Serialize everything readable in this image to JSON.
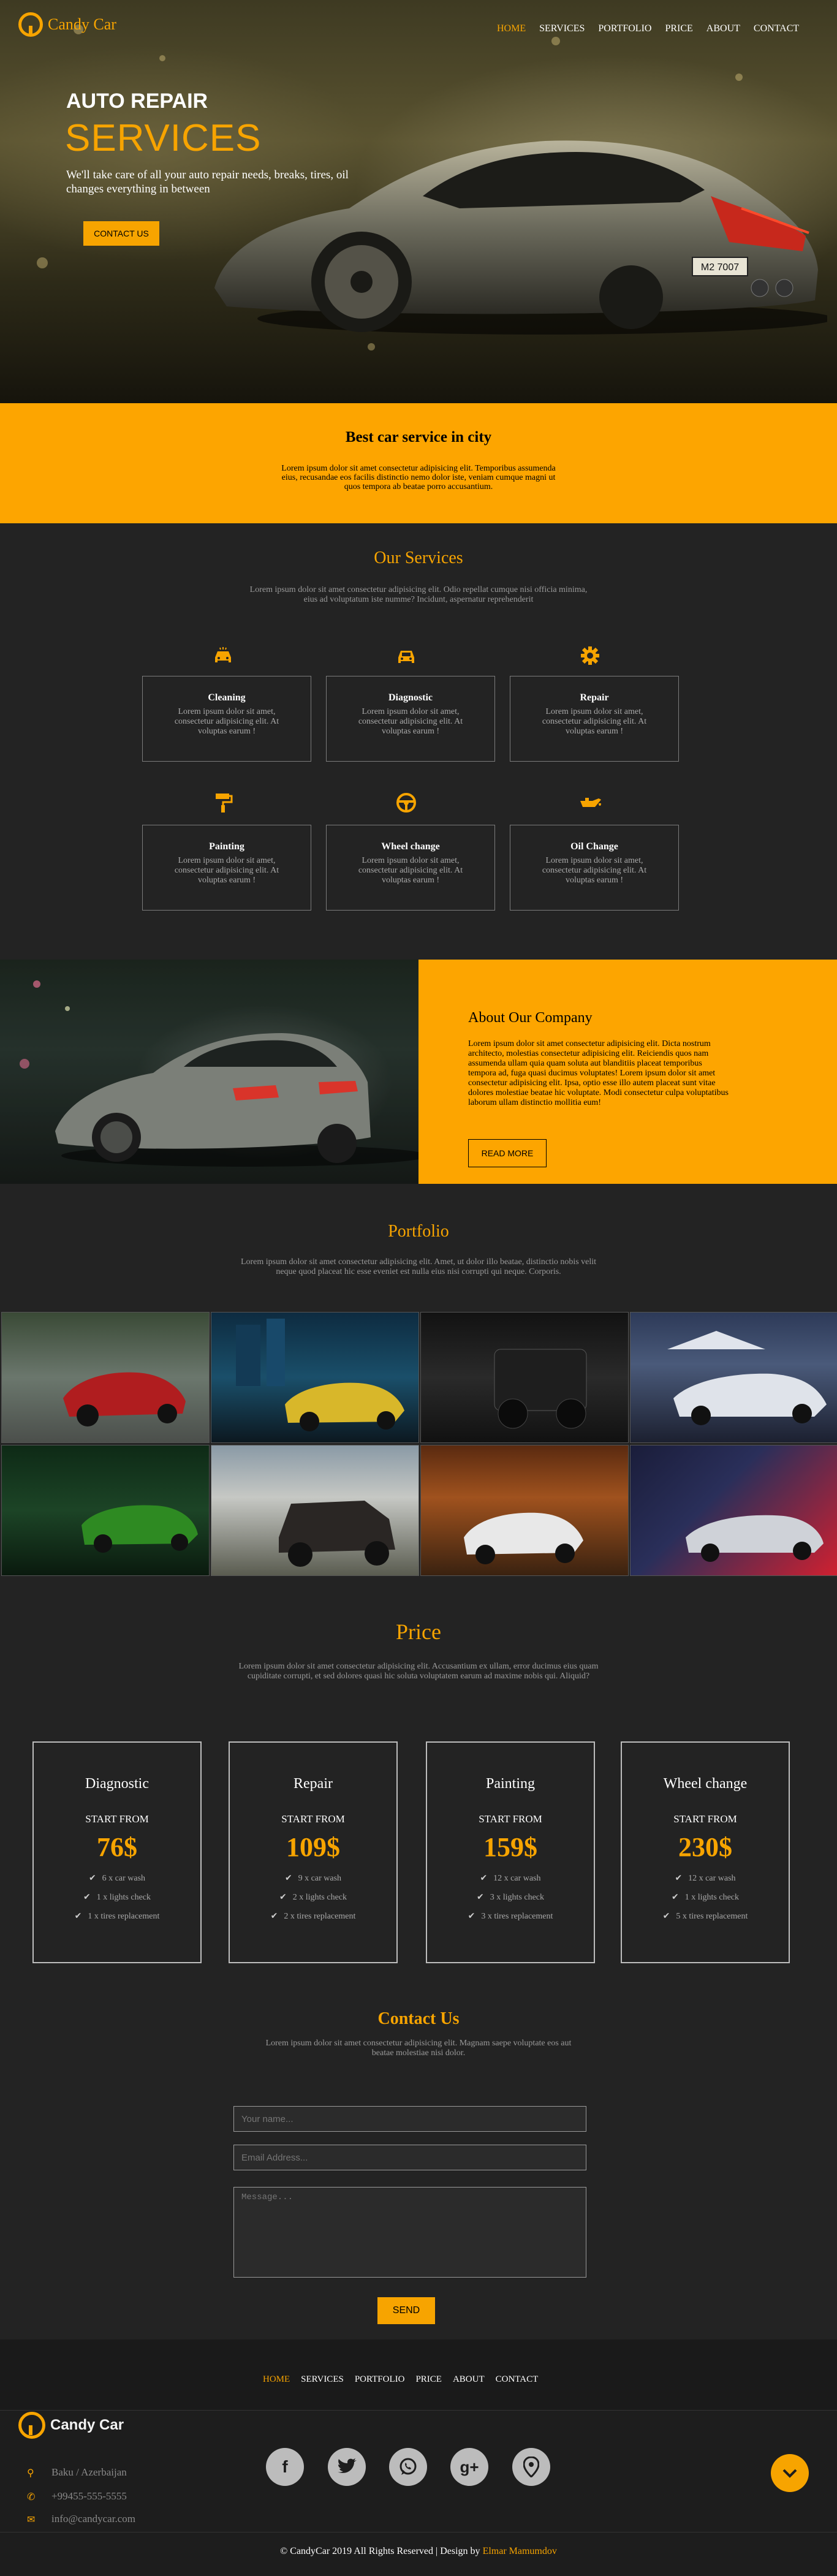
{
  "brand": {
    "name": "Candy Car",
    "name_part1": "Candy",
    "name_part2": "Car"
  },
  "nav": {
    "items": [
      "HOME",
      "SERVICES",
      "PORTFOLIO",
      "PRICE",
      "ABOUT",
      "CONTACT"
    ],
    "active": "HOME"
  },
  "hero": {
    "line1": "AUTO REPAIR",
    "line2": "SERVICES",
    "desc": "We'll take care of all your auto repair needs, breaks, tires, oil changes everything in between",
    "button": "CONTACT US",
    "plate": "M2 7007"
  },
  "best": {
    "title": "Best car service in city",
    "text": "Lorem ipsum dolor sit amet consectetur adipisicing elit. Temporibus assumenda eius, recusandae eos facilis distinctio nemo dolor iste, veniam cumque magni ut quos tempora ab beatae porro accusantium."
  },
  "services": {
    "title": "Our Services",
    "subtitle": "Lorem ipsum dolor sit amet consectetur adipisicing elit. Odio repellat cumque nisi officia minima, eius ad voluptatum iste numme? Incidunt, aspernatur reprehenderit",
    "items": [
      {
        "name": "Cleaning",
        "icon": "cleaning-car-icon",
        "desc": "Lorem ipsum dolor sit amet, consectetur adipisicing elit. At voluptas earum !"
      },
      {
        "name": "Diagnostic",
        "icon": "diagnostic-car-icon",
        "desc": "Lorem ipsum dolor sit amet, consectetur adipisicing elit. At voluptas earum !"
      },
      {
        "name": "Repair",
        "icon": "gear-icon",
        "desc": "Lorem ipsum dolor sit amet, consectetur adipisicing elit. At voluptas earum !"
      },
      {
        "name": "Painting",
        "icon": "paint-roller-icon",
        "desc": "Lorem ipsum dolor sit amet, consectetur adipisicing elit. At voluptas earum !"
      },
      {
        "name": "Wheel change",
        "icon": "steering-wheel-icon",
        "desc": "Lorem ipsum dolor sit amet, consectetur adipisicing elit. At voluptas earum !"
      },
      {
        "name": "Oil Change",
        "icon": "oil-can-icon",
        "desc": "Lorem ipsum dolor sit amet, consectetur adipisicing elit. At voluptas earum !"
      }
    ]
  },
  "about": {
    "title": "About Our Company",
    "text": "Lorem ipsum dolor sit amet consectetur adipisicing elit. Dicta nostrum architecto, molestias consectetur adipisicing elit. Reiciendis quos nam assumenda ullam quia quam soluta aut blanditiis placeat temporibus tempora ad, fuga quasi ducimus voluptates! Lorem ipsum dolor sit amet consectetur adipisicing elit. Ipsa, optio esse illo autem placeat sunt vitae dolores molestiae beatae hic voluptate. Modi consectetur culpa voluptatibus laborum ullam distinctio mollitia eum!",
    "button": "READ MORE"
  },
  "portfolio": {
    "title": "Portfolio",
    "subtitle": "Lorem ipsum dolor sit amet consectetur adipisicing elit. Amet, ut dolor illo beatae, distinctio nobis velit neque quod placeat hic esse eveniet est nulla eius nisi corrupti qui neque. Corporis."
  },
  "price": {
    "title": "Price",
    "subtitle": "Lorem ipsum dolor sit amet consectetur adipisicing elit. Accusantium ex ullam, error ducimus eius quam cupiditate corrupti, et sed dolores quasi hic soluta voluptatem earum ad maxime nobis qui. Aliquid?",
    "start_label": "START FROM",
    "plans": [
      {
        "name": "Diagnostic",
        "price": "76$",
        "features": [
          "6 x car wash",
          "1 x lights check",
          "1 x tires replacement"
        ]
      },
      {
        "name": "Repair",
        "price": "109$",
        "features": [
          "9 x car wash",
          "2 x lights check",
          "2 x tires replacement"
        ]
      },
      {
        "name": "Painting",
        "price": "159$",
        "features": [
          "12 x car wash",
          "3 x lights check",
          "3 x tires replacement"
        ]
      },
      {
        "name": "Wheel change",
        "price": "230$",
        "features": [
          "12 x car wash",
          "1 x lights check",
          "5 x tires replacement"
        ]
      }
    ]
  },
  "contact": {
    "title": "Contact Us",
    "subtitle": "Lorem ipsum dolor sit amet consectetur adipisicing elit. Magnam saepe voluptate eos aut beatae molestiae nisi dolor.",
    "name_placeholder": "Your name...",
    "email_placeholder": "Email Address...",
    "message_placeholder": "Message...",
    "send": "SEND"
  },
  "footer": {
    "address": "Baku / Azerbaijan",
    "phone": "+99455-555-5555",
    "email": "info@candycar.com",
    "copyright_prefix": "© CandyCar 2019 All Rights Reserved | Design by",
    "designer": "Elmar Mamumdov"
  },
  "colors": {
    "accent": "#f7a400",
    "accent_panel": "#fda500",
    "background": "#232323"
  }
}
